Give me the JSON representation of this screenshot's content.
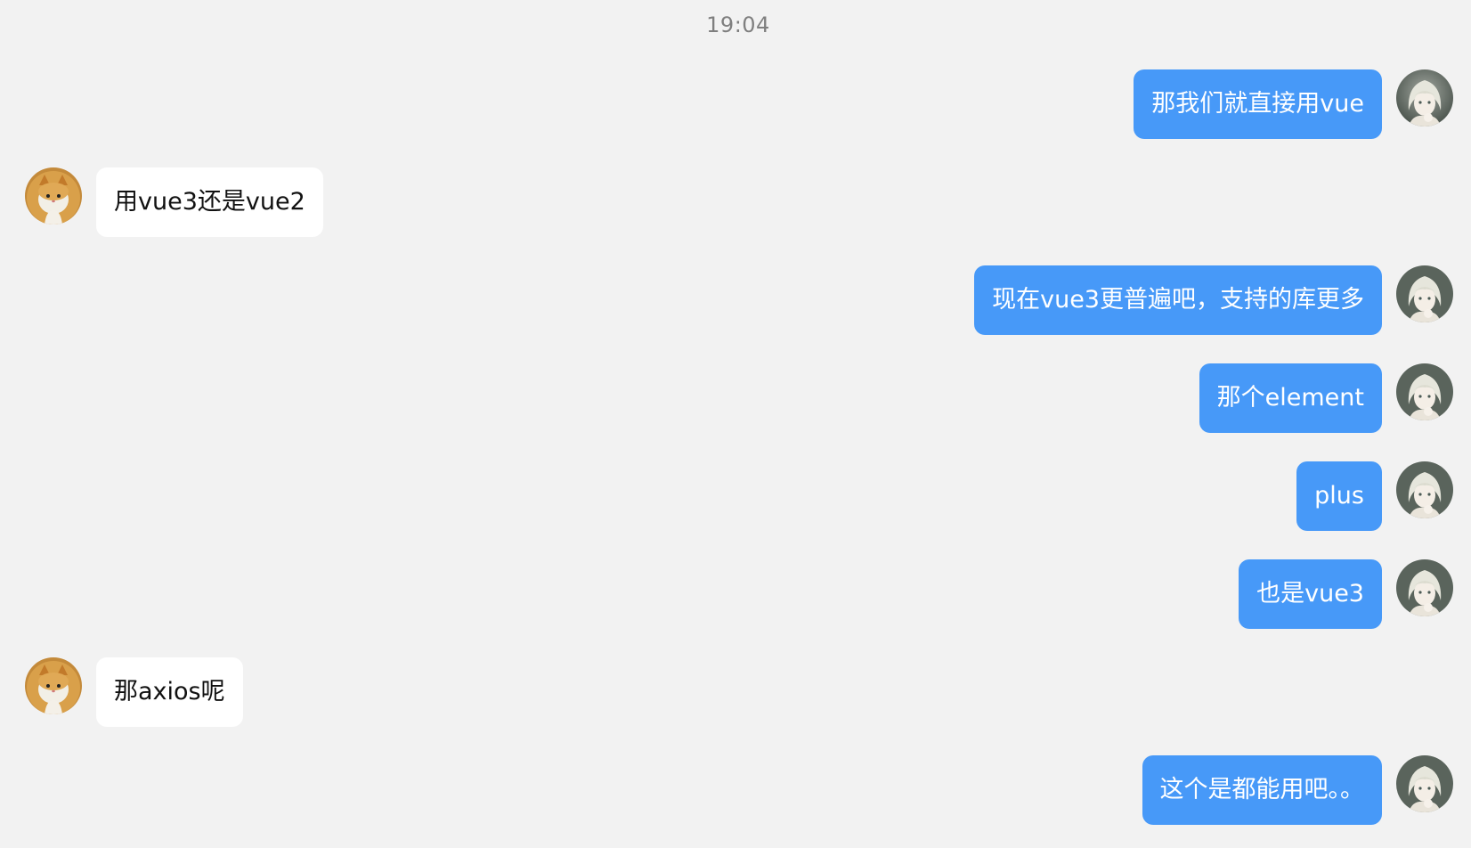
{
  "timestamp": "19:04",
  "colors": {
    "background": "#f2f2f2",
    "outgoing_bubble": "#4799f8",
    "incoming_bubble": "#ffffff",
    "timestamp_text": "#7f7f7f"
  },
  "avatars": {
    "self": "anime-girl-avatar",
    "other": "cat-avatar"
  },
  "messages": [
    {
      "direction": "out",
      "text": "那我们就直接用vue"
    },
    {
      "direction": "in",
      "text": "用vue3还是vue2"
    },
    {
      "direction": "out",
      "text": "现在vue3更普遍吧，支持的库更多"
    },
    {
      "direction": "out",
      "text": "那个element"
    },
    {
      "direction": "out",
      "text": "plus"
    },
    {
      "direction": "out",
      "text": "也是vue3"
    },
    {
      "direction": "in",
      "text": "那axios呢"
    },
    {
      "direction": "out",
      "text": "这个是都能用吧。。"
    }
  ]
}
